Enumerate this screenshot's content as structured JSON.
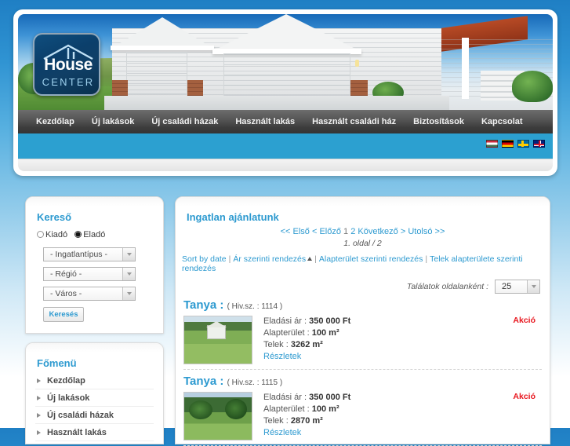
{
  "site": {
    "logo_primary": "House",
    "logo_secondary": "CENTER"
  },
  "nav": {
    "items": [
      {
        "label": "Kezdőlap"
      },
      {
        "label": "Új lakások"
      },
      {
        "label": "Új családi házak"
      },
      {
        "label": "Használt lakás"
      },
      {
        "label": "Használt családi ház"
      },
      {
        "label": "Biztosítások"
      },
      {
        "label": "Kapcsolat"
      }
    ]
  },
  "languages": [
    {
      "name": "hungarian-flag"
    },
    {
      "name": "german-flag"
    },
    {
      "name": "swedish-flag"
    },
    {
      "name": "uk-flag"
    }
  ],
  "search_box": {
    "title": "Kereső",
    "radio_rent": "Kiadó",
    "radio_sale": "Eladó",
    "selected": "Eladó",
    "selects": [
      {
        "value": "- Ingatlantípus -"
      },
      {
        "value": "- Régió -"
      },
      {
        "value": "- Város -"
      }
    ],
    "submit_label": "Keresés"
  },
  "menu_box": {
    "title": "Főmenü",
    "items": [
      {
        "label": "Kezdőlap"
      },
      {
        "label": "Új lakások"
      },
      {
        "label": "Új családi házak"
      },
      {
        "label": "Használt lakás"
      }
    ]
  },
  "main": {
    "title": "Ingatlan ajánlatunk",
    "pager": {
      "first": "<< Első",
      "prev": "< Előző",
      "page1": "1",
      "page2": "2",
      "next": "Következő >",
      "last": "Utolsó >>",
      "info": "1. oldal / 2"
    },
    "sort": {
      "by_date": "Sort by date",
      "by_price": "Ár szerinti rendezés",
      "by_area": "Alapterület szerinti rendezés",
      "by_lot": "Telek alapterülete szerinti rendezés"
    },
    "per_page": {
      "label": "Találatok oldalanként :",
      "value": "25"
    },
    "listings": [
      {
        "title": "Tanya :",
        "ref": "( Hiv.sz. : 1114 )",
        "price_label": "Eladási ár :",
        "price_value": "350 000 Ft",
        "area_label": "Alapterület :",
        "area_value": "100 m²",
        "lot_label": "Telek :",
        "lot_value": "3262 m²",
        "details_link": "Részletek",
        "badge": "Akció"
      },
      {
        "title": "Tanya :",
        "ref": "( Hiv.sz. : 1115 )",
        "price_label": "Eladási ár :",
        "price_value": "350 000 Ft",
        "area_label": "Alapterület :",
        "area_value": "100 m²",
        "lot_label": "Telek :",
        "lot_value": "2870 m²",
        "details_link": "Részletek",
        "badge": "Akció"
      }
    ]
  },
  "colors": {
    "accent_blue": "#2d9ad0",
    "strip_blue": "#2ca0d0",
    "nav_dark": "#3c3c3c",
    "badge_red": "#e8171f"
  }
}
